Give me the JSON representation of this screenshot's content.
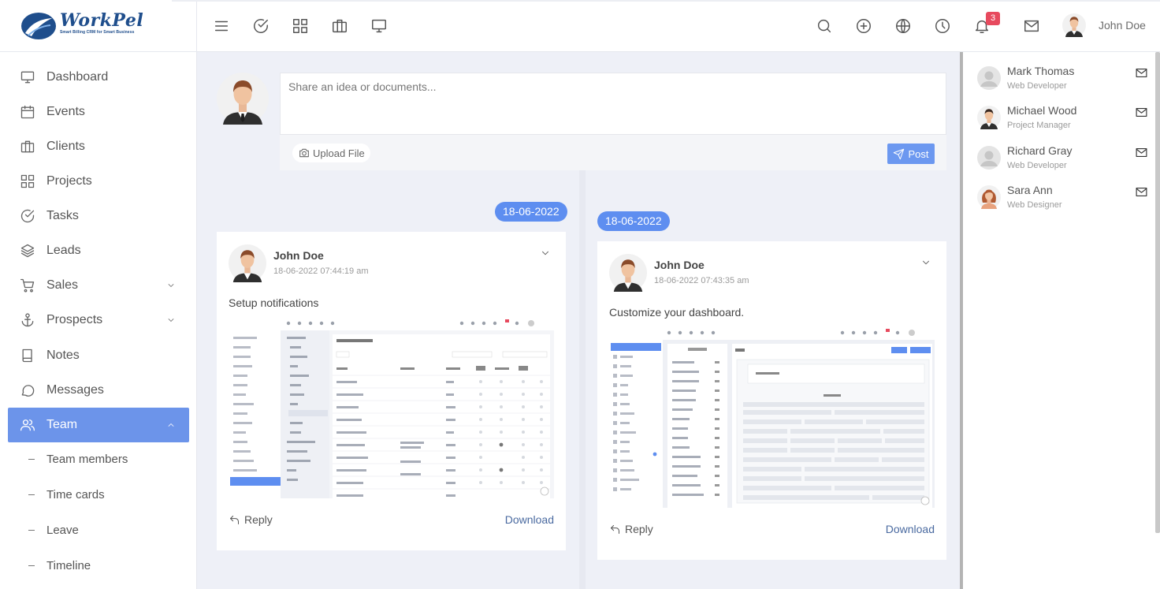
{
  "brand": {
    "name": "WorkPel",
    "tagline": "Smart Billing CRM for Smart Business"
  },
  "topbar": {
    "left_icons": [
      "menu-icon",
      "check-circle-icon",
      "grid-icon",
      "briefcase-icon",
      "monitor-icon"
    ],
    "right_icons": [
      "search-icon",
      "plus-circle-icon",
      "globe-icon",
      "clock-icon",
      "bell-icon",
      "mail-icon"
    ],
    "notification_count": "3",
    "user_name": "John Doe"
  },
  "sidebar": {
    "items": [
      {
        "label": "Dashboard",
        "icon": "monitor-icon"
      },
      {
        "label": "Events",
        "icon": "calendar-icon"
      },
      {
        "label": "Clients",
        "icon": "briefcase-icon"
      },
      {
        "label": "Projects",
        "icon": "grid-icon"
      },
      {
        "label": "Tasks",
        "icon": "check-circle-icon"
      },
      {
        "label": "Leads",
        "icon": "layers-icon"
      },
      {
        "label": "Sales",
        "icon": "cart-icon",
        "expandable": true
      },
      {
        "label": "Prospects",
        "icon": "anchor-icon",
        "expandable": true
      },
      {
        "label": "Notes",
        "icon": "book-icon"
      },
      {
        "label": "Messages",
        "icon": "message-icon"
      },
      {
        "label": "Team",
        "icon": "users-icon",
        "active": true,
        "expanded": true
      }
    ],
    "team_sub_items": [
      "Team members",
      "Time cards",
      "Leave",
      "Timeline"
    ]
  },
  "composer": {
    "placeholder": "Share an idea or documents...",
    "upload_label": "Upload File",
    "post_label": "Post"
  },
  "timeline": {
    "posts": [
      {
        "date": "18-06-2022",
        "author": "John Doe",
        "timestamp": "18-06-2022 07:44:19 am",
        "text": "Setup notifications",
        "reply_label": "Reply",
        "download_label": "Download",
        "attachment": "notification-settings-screenshot"
      },
      {
        "date": "18-06-2022",
        "author": "John Doe",
        "timestamp": "18-06-2022 07:43:35 am",
        "text": "Customize your dashboard.",
        "reply_label": "Reply",
        "download_label": "Download",
        "attachment": "dashboard-tasks-screenshot"
      }
    ]
  },
  "team_panel": {
    "members": [
      {
        "name": "Mark Thomas",
        "role": "Web Developer",
        "avatar": "placeholder"
      },
      {
        "name": "Michael Wood",
        "role": "Project Manager",
        "avatar": "man"
      },
      {
        "name": "Richard Gray",
        "role": "Web Developer",
        "avatar": "placeholder"
      },
      {
        "name": "Sara Ann",
        "role": "Web Designer",
        "avatar": "woman"
      }
    ]
  },
  "colors": {
    "accent": "#6c94ea",
    "button": "#5e8ef0",
    "badge": "#e74a5e",
    "brand": "#1f4e8c"
  }
}
